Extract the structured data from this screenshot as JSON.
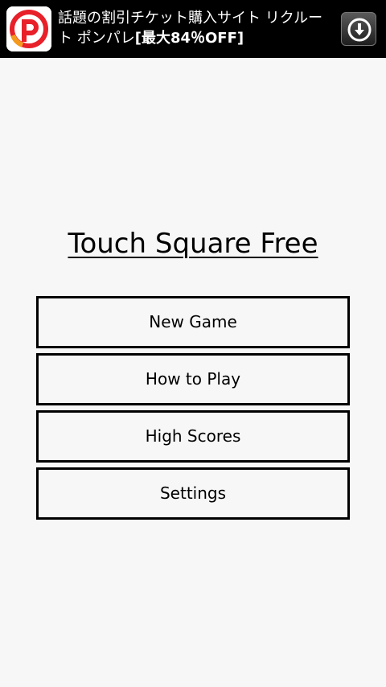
{
  "ad": {
    "text_prefix": "話題の割引チケット購入サイト リクルート ポンパレ",
    "text_bold": "[最大84％OFF]",
    "logo_icon": "ponpare-logo-icon",
    "download_icon": "download-arrow-icon",
    "colors": {
      "background": "#000000",
      "text": "#ffffff",
      "logo_red": "#e8202a",
      "logo_orange": "#f39a1e"
    }
  },
  "main": {
    "title": "Touch Square Free",
    "menu": [
      {
        "label": "New Game"
      },
      {
        "label": "How to Play"
      },
      {
        "label": "High Scores"
      },
      {
        "label": "Settings"
      }
    ]
  },
  "colors": {
    "page_background": "#f7f7f7",
    "button_border": "#000000",
    "text": "#000000"
  }
}
